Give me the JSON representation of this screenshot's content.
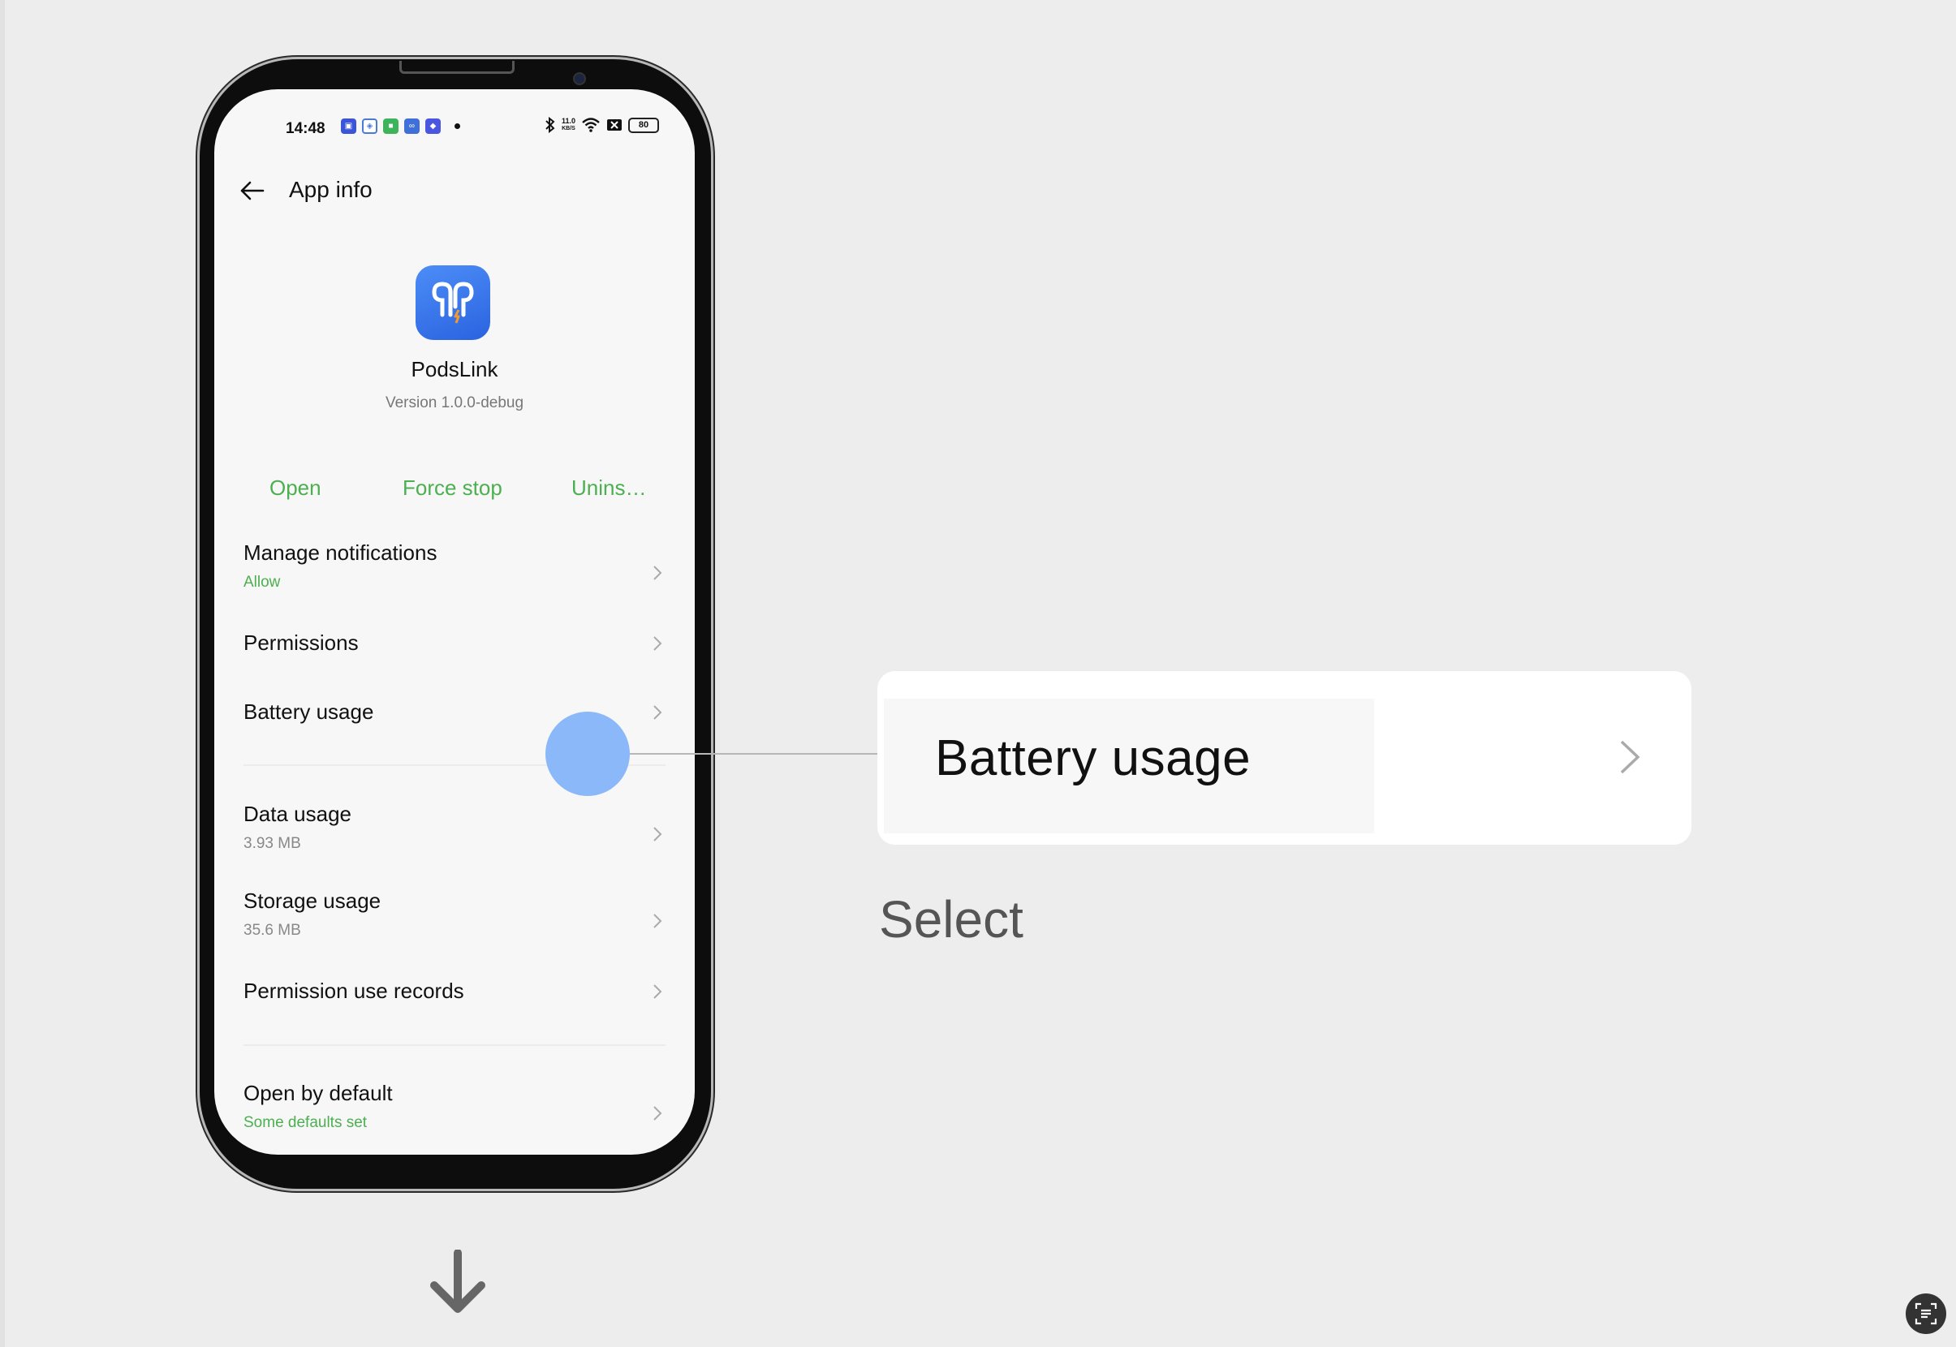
{
  "status_bar": {
    "time": "14:48",
    "net_speed_value": "11.0",
    "net_speed_unit": "KB/S",
    "battery": "80"
  },
  "header": {
    "title": "App info"
  },
  "app": {
    "name": "PodsLink",
    "version": "Version 1.0.0-debug",
    "icon": "earbuds-icon"
  },
  "actions": {
    "open": "Open",
    "force_stop": "Force stop",
    "uninstall": "Unins…"
  },
  "settings": {
    "manage_notifications": {
      "label": "Manage notifications",
      "value": "Allow"
    },
    "permissions": {
      "label": "Permissions"
    },
    "battery_usage": {
      "label": "Battery usage"
    },
    "data_usage": {
      "label": "Data usage",
      "value": "3.93 MB"
    },
    "storage_usage": {
      "label": "Storage usage",
      "value": "35.6 MB"
    },
    "permission_use_records": {
      "label": "Permission use records"
    },
    "open_by_default": {
      "label": "Open by default",
      "value": "Some defaults set"
    }
  },
  "zoom_card": {
    "label": "Battery usage"
  },
  "caption": "Select",
  "colors": {
    "accent_green": "#4caf50",
    "touch_blue": "#8bb8f9",
    "app_icon_blue": "#3b78ec"
  }
}
